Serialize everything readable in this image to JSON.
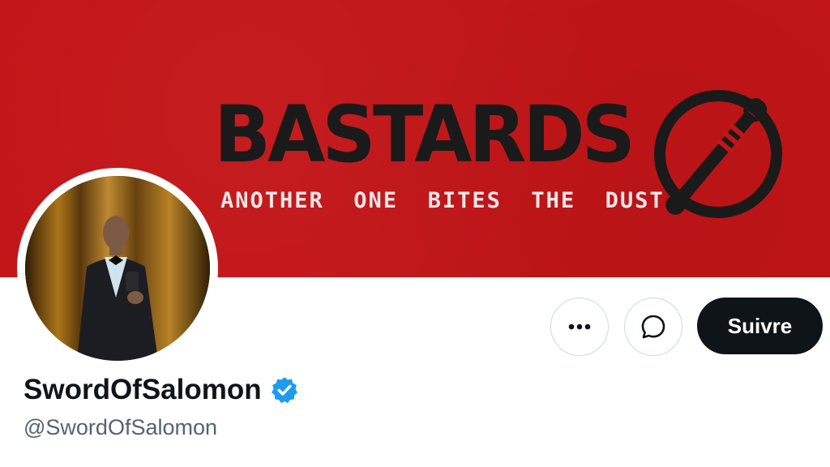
{
  "banner": {
    "brand_name": "BASTARDS",
    "tagline": "ANOTHER  ONE  BITES  THE  DUST",
    "background_color": "#c21518",
    "emblem_icon": "crossed-circle-blade-icon"
  },
  "profile": {
    "display_name": "SwordOfSalomon",
    "handle": "@SwordOfSalomon",
    "verified": true,
    "verified_color": "#1d9bf0",
    "avatar": "avatar-photo"
  },
  "actions": {
    "more_icon": "more-dots-icon",
    "message_icon": "message-bubble-icon",
    "follow_label": "Suivre"
  }
}
